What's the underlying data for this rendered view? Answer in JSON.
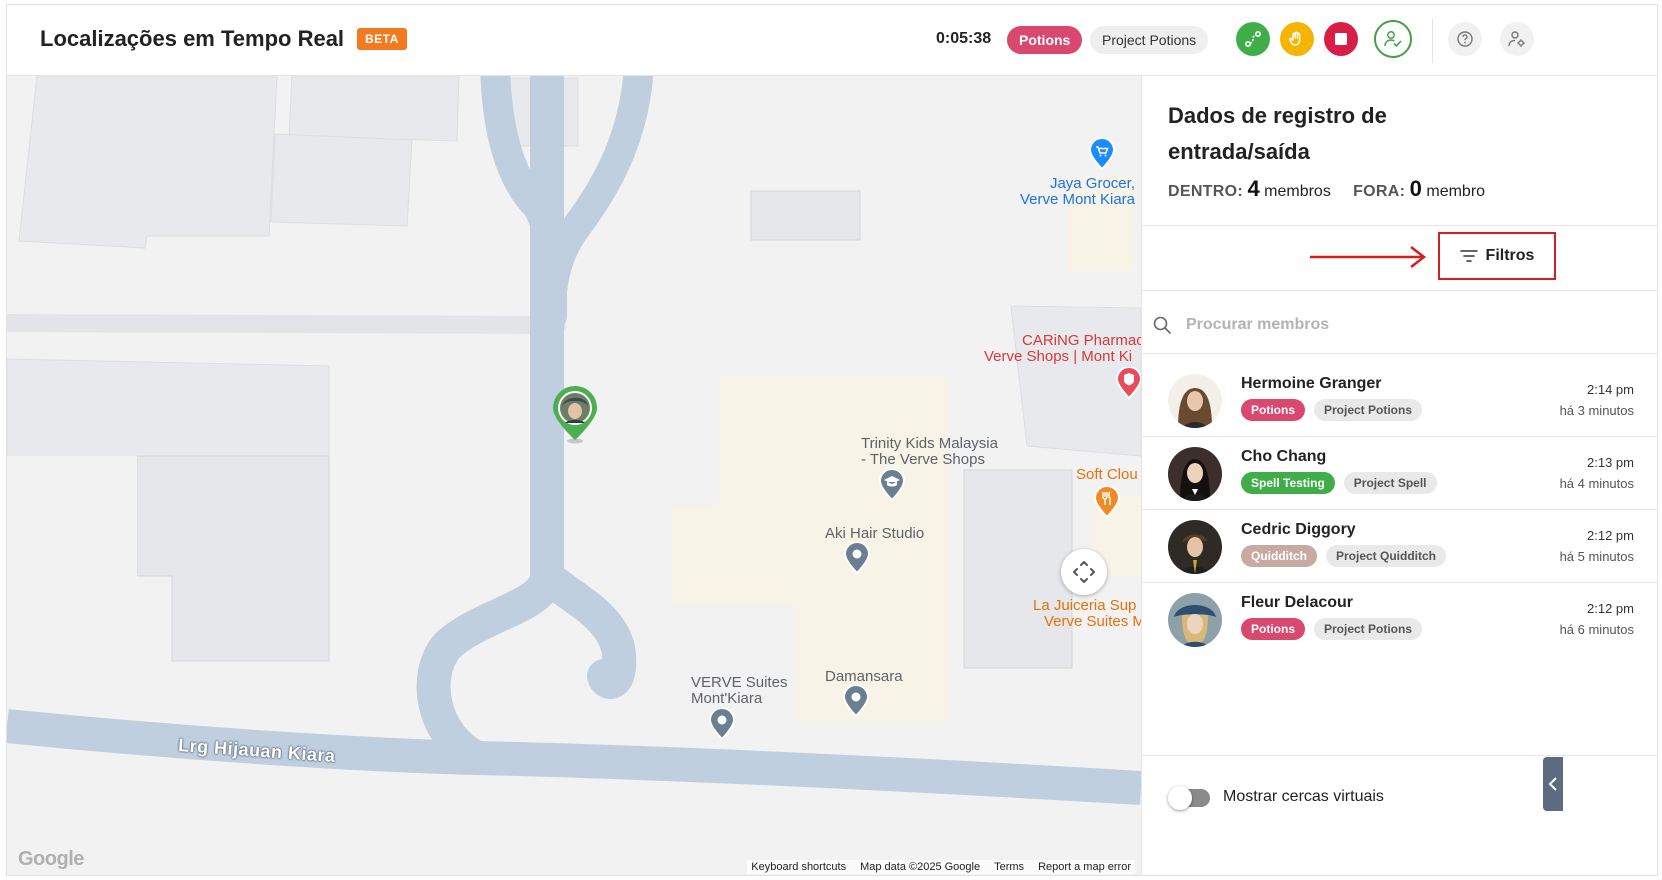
{
  "header": {
    "title": "Localizações em Tempo Real",
    "badge": "BETA",
    "timer": "0:05:38",
    "group_chip": "Potions",
    "project_chip": "Project Potions",
    "colors": {
      "potions": "#d9486f",
      "green": "#3fae49",
      "yellow": "#f4b400",
      "red": "#d81e47"
    },
    "icons": [
      "route-icon",
      "hand-icon",
      "stop-icon",
      "user-check-icon",
      "help-icon",
      "settings-user-icon"
    ]
  },
  "map": {
    "road_name": "Lrg Hijauan Kiara",
    "pois": {
      "jaya": [
        "Jaya Grocer,",
        "Verve Mont Kiara"
      ],
      "caring": [
        "CARiNG Pharmac",
        "Verve Shops | Mont Ki"
      ],
      "trinity": [
        "Trinity Kids Malaysia",
        "- The Verve Shops"
      ],
      "soft": "Soft Clou",
      "aki": "Aki Hair Studio",
      "juiceria": [
        "La Juiceria Sup",
        "Verve Suites M"
      ],
      "verve_suites": [
        "VERVE Suites",
        "Mont'Kiara"
      ],
      "damansara": "Damansara"
    },
    "footer": [
      "Keyboard shortcuts",
      "Map data ©2025 Google",
      "Terms",
      "Report a map error"
    ],
    "logo": "Google"
  },
  "panel": {
    "title": "Dados de registro de entrada/saída",
    "inside_label": "DENTRO:",
    "inside_count": "4",
    "inside_unit": "membros",
    "outside_label": "FORA:",
    "outside_count": "0",
    "outside_unit": "membro",
    "filter_label": "Filtros",
    "search_placeholder": "Procurar membros",
    "members": [
      {
        "name": "Hermoine Granger",
        "tags": [
          {
            "label": "Potions",
            "bg": "#d9486f",
            "fg": "#ffffff"
          },
          {
            "label": "Project Potions",
            "bg": "#e9e9e9",
            "fg": "#555555"
          }
        ],
        "time": "2:14 pm",
        "ago": "há 3 minutos"
      },
      {
        "name": "Cho Chang",
        "tags": [
          {
            "label": "Spell Testing",
            "bg": "#3fae49",
            "fg": "#ffffff"
          },
          {
            "label": "Project Spell",
            "bg": "#e9e9e9",
            "fg": "#555555"
          }
        ],
        "time": "2:13 pm",
        "ago": "há 4 minutos"
      },
      {
        "name": "Cedric Diggory",
        "tags": [
          {
            "label": "Quidditch",
            "bg": "#c9aaa3",
            "fg": "#ffffff"
          },
          {
            "label": "Project Quidditch",
            "bg": "#e9e9e9",
            "fg": "#555555"
          }
        ],
        "time": "2:12 pm",
        "ago": "há 5 minutos"
      },
      {
        "name": "Fleur Delacour",
        "tags": [
          {
            "label": "Potions",
            "bg": "#d9486f",
            "fg": "#ffffff"
          },
          {
            "label": "Project Potions",
            "bg": "#e9e9e9",
            "fg": "#555555"
          }
        ],
        "time": "2:12 pm",
        "ago": "há 6 minutos"
      }
    ],
    "geofence_label": "Mostrar cercas virtuais",
    "geofence_on": false
  }
}
